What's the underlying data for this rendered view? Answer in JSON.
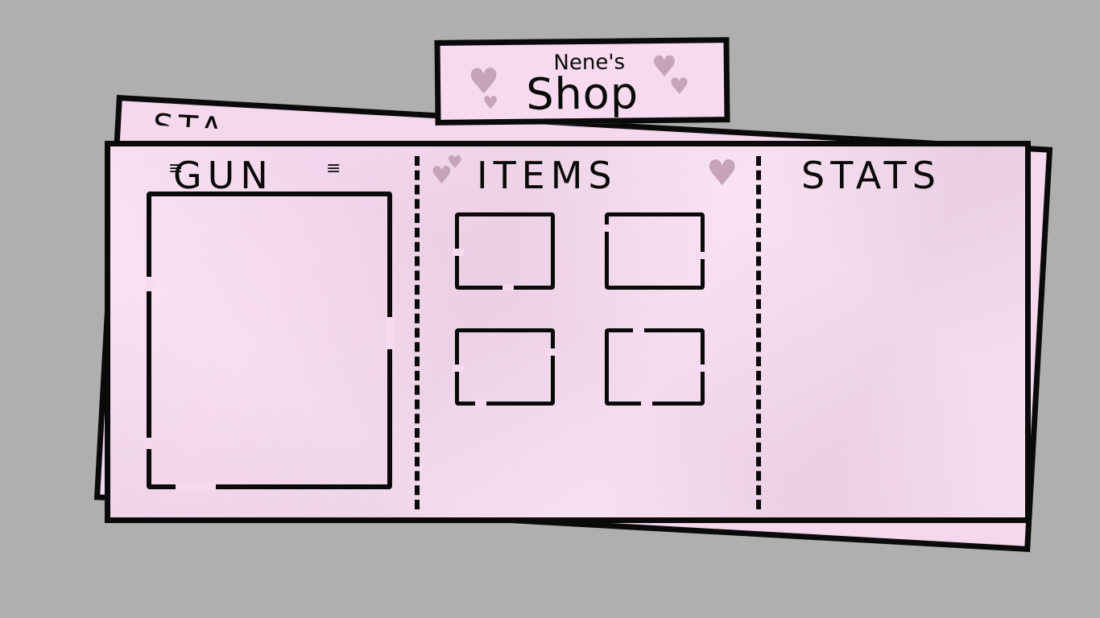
{
  "sign": {
    "owner": "Nene's",
    "title": "Shop"
  },
  "back_paper": {
    "partial_label": "STA"
  },
  "columns": {
    "gun": {
      "title": "GUN",
      "sparks_left": "≡",
      "sparks_right": "≡"
    },
    "items": {
      "title": "ITEMS"
    },
    "stats": {
      "title": "STATS"
    }
  },
  "item_slots": [
    {
      "label": ""
    },
    {
      "label": ""
    },
    {
      "label": ""
    },
    {
      "label": ""
    }
  ],
  "decor": {
    "heart_glyph": "♥",
    "heart_color": "#c6a3ba",
    "paper_color": "#f7d9f0",
    "background_color": "#afafaf",
    "ink_color": "#0a0a0a"
  }
}
